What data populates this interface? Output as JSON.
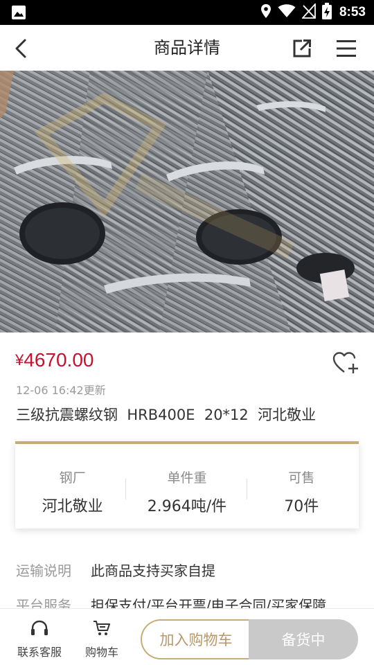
{
  "status_bar": {
    "time": "8:53",
    "icons": [
      "image-icon",
      "location-icon",
      "wifi-icon",
      "no-signal-icon",
      "battery-charging-icon"
    ]
  },
  "header": {
    "title": "商品详情",
    "icons": [
      "back-arrow-icon",
      "share-icon",
      "menu-icon"
    ]
  },
  "product": {
    "image_subject": "rebar-bundles-photo",
    "currency_symbol": "¥",
    "price": "4670.00",
    "updated": "12-06 16:42更新",
    "title": "三级抗震螺纹钢  HRB400E  20*12  河北敬业"
  },
  "specs": [
    {
      "label": "钢厂",
      "value": "河北敬业"
    },
    {
      "label": "单件重",
      "value": "2.964吨/件"
    },
    {
      "label": "可售",
      "value": "70件"
    }
  ],
  "info": {
    "shipping_label": "运输说明",
    "shipping_value": "此商品支持买家自提",
    "service_label": "平台服务",
    "service_value": "担保支付/平台开票/电子合同/买家保障"
  },
  "bottom_bar": {
    "service_label": "联系客服",
    "cart_label": "购物车",
    "add_to_cart": "加入购物车",
    "stocking": "备货中"
  },
  "colors": {
    "price": "#c8102e",
    "accent_gold": "#c7ab76",
    "disabled_button": "#c9c9c9",
    "status_bar": "#000000"
  }
}
